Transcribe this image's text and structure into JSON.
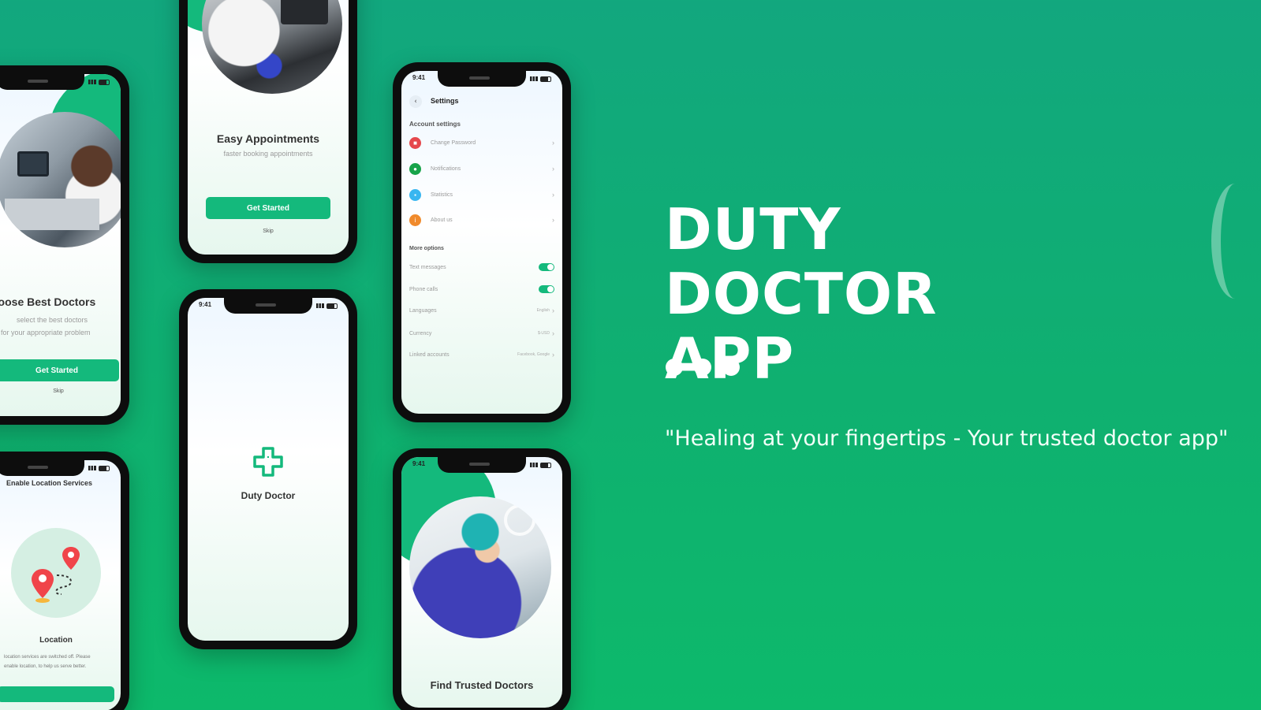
{
  "hero": {
    "title_line1": "DUTY DOCTOR",
    "title_line2": "APP",
    "tagline": "\"Healing at your fingertips - Your trusted doctor app\""
  },
  "colors": {
    "brand_green": "#14b97c",
    "background": "#0fb070",
    "text_light": "#ffffff"
  },
  "phones": {
    "status_time": "9:41",
    "choose_doctors": {
      "title": "hoose Best Doctors",
      "subtitle_line1": "select the best doctors",
      "subtitle_line2": "for your appropriate problem",
      "button": "Get Started",
      "skip": "Skip"
    },
    "easy_appointments": {
      "title": "Easy Appointments",
      "subtitle": "faster booking appointments",
      "button": "Get Started",
      "skip": "Skip"
    },
    "splash": {
      "brand": "Duty Doctor"
    },
    "settings": {
      "header": "Settings",
      "section_account": "Account settings",
      "account_items": [
        "Change Password",
        "Notifications",
        "Statistics",
        "About us"
      ],
      "section_more": "More options",
      "toggle_items": [
        "Text messages",
        "Phone calls"
      ],
      "value_items": [
        {
          "label": "Languages",
          "value": "English"
        },
        {
          "label": "Currency",
          "value": "$-USD"
        },
        {
          "label": "Linked accounts",
          "value": "Facebook, Google"
        }
      ]
    },
    "location": {
      "header": "Enable Location Services",
      "title": "Location",
      "body_line1": "location services are switched off. Please",
      "body_line2": "enable location, to help us serve better."
    },
    "trusted": {
      "title": "Find Trusted Doctors"
    }
  },
  "icons": [
    "lock-icon",
    "bell-icon",
    "chart-icon",
    "info-icon",
    "medical-cross-icon",
    "map-pin-icon",
    "back-chevron-icon"
  ]
}
